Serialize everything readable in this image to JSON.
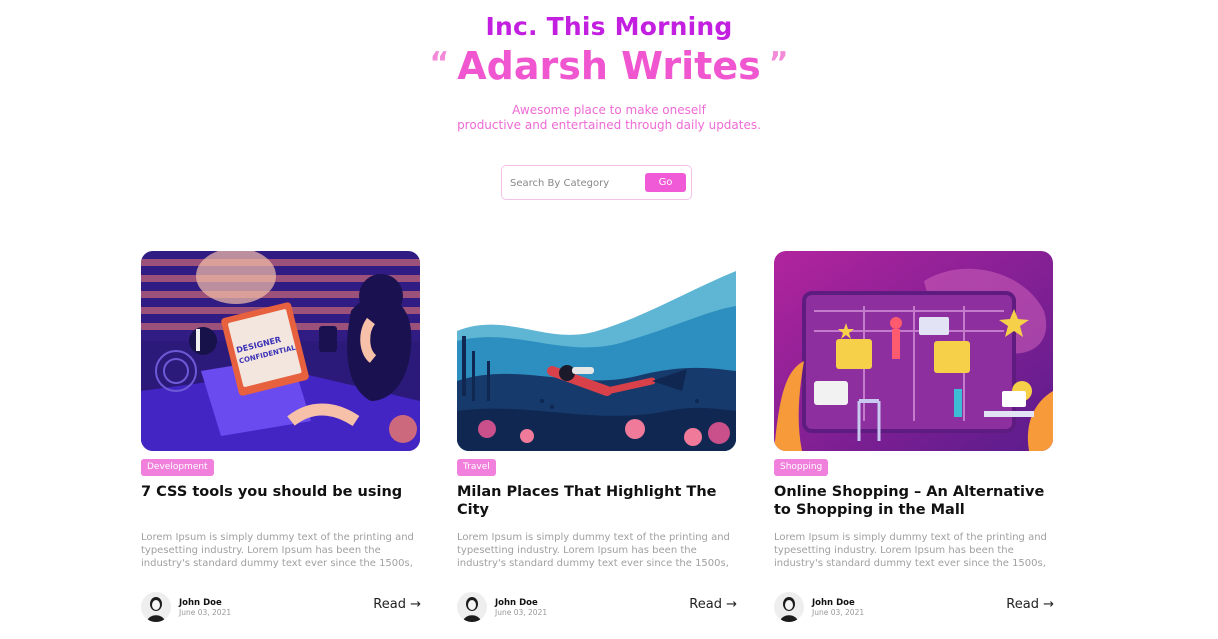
{
  "header": {
    "kicker": "Inc. This Morning",
    "open_quote": "“",
    "title": "Adarsh Writes",
    "close_quote": "”",
    "tagline_line1": "Awesome place to make oneself",
    "tagline_line2": "productive and entertained through daily updates."
  },
  "search": {
    "placeholder": "Search By Category",
    "button_label": "Go"
  },
  "colors": {
    "accent": "#f056cf",
    "kicker": "#c21fe0",
    "badge": "#f17fdc"
  },
  "posts": [
    {
      "category": "Development",
      "title": "7 CSS tools you should be using",
      "excerpt": "Lorem Ipsum is simply dummy text of the printing and typesetting industry. Lorem Ipsum has been the industry's standard dummy text ever since the 1500s, ...",
      "author": "John Doe",
      "date": "June 03, 2021",
      "read_label": "Read →",
      "image_icon": "designer-at-laptop-illustration"
    },
    {
      "category": "Travel",
      "title": "Milan Places That Highlight The City",
      "excerpt": "Lorem Ipsum is simply dummy text of the printing and typesetting industry. Lorem Ipsum has been the industry's standard dummy text ever since the 1500s, ...",
      "author": "John Doe",
      "date": "June 03, 2021",
      "read_label": "Read →",
      "image_icon": "scuba-diver-illustration"
    },
    {
      "category": "Shopping",
      "title": "Online Shopping – An Alternative to Shopping in the Mall",
      "excerpt": "Lorem Ipsum is simply dummy text of the printing and typesetting industry. Lorem Ipsum has been the industry's standard dummy text ever since the 1500s, ...",
      "author": "John Doe",
      "date": "June 03, 2021",
      "read_label": "Read →",
      "image_icon": "online-shopping-illustration"
    }
  ]
}
